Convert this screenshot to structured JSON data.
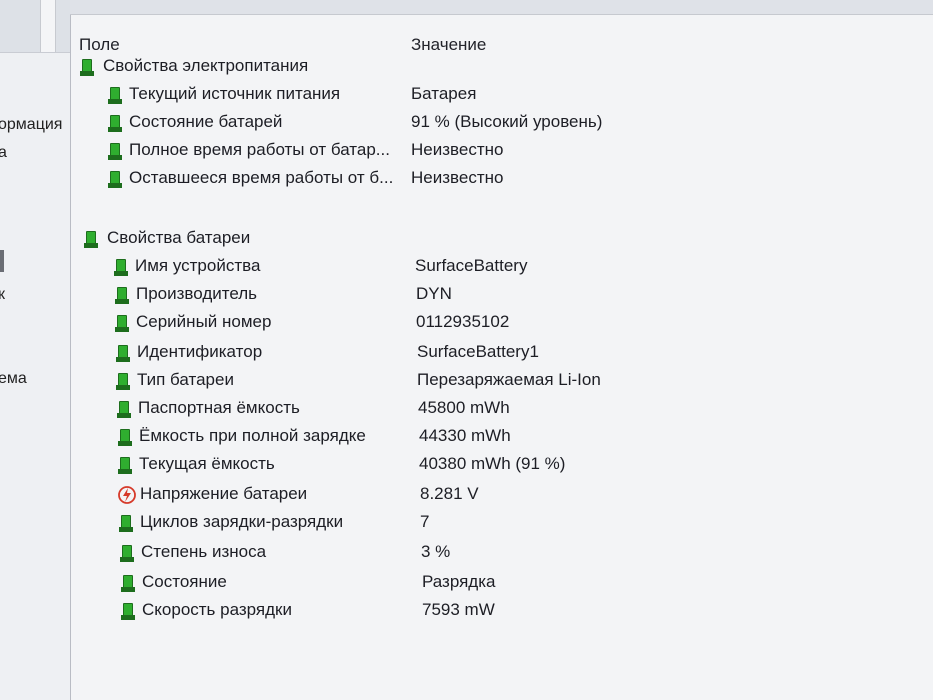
{
  "left_panel": {
    "items": [
      {
        "label": "ормация"
      },
      {
        "label": "а"
      },
      {
        "label": "к"
      },
      {
        "label": "ема"
      }
    ]
  },
  "header": {
    "field_label": "Поле",
    "value_label": "Значение"
  },
  "sections": [
    {
      "title": "Свойства электропитания",
      "rows": [
        {
          "field": "Текущий источник питания",
          "value": "Батарея",
          "icon": "battery-icon"
        },
        {
          "field": "Состояние батарей",
          "value": "91 % (Высокий уровень)",
          "icon": "battery-icon"
        },
        {
          "field": "Полное время работы от батар...",
          "value": "Неизвестно",
          "icon": "battery-icon"
        },
        {
          "field": "Оставшееся время работы от б...",
          "value": "Неизвестно",
          "icon": "battery-icon"
        }
      ]
    },
    {
      "title": "Свойства батареи",
      "rows": [
        {
          "field": "Имя устройства",
          "value": "SurfaceBattery",
          "icon": "battery-icon"
        },
        {
          "field": "Производитель",
          "value": "DYN",
          "icon": "battery-icon"
        },
        {
          "field": "Серийный номер",
          "value": "0112935102",
          "icon": "battery-icon"
        },
        {
          "field": "Идентификатор",
          "value": "SurfaceBattery1",
          "icon": "battery-icon"
        },
        {
          "field": "Тип батареи",
          "value": "Перезаряжаемая Li-Ion",
          "icon": "battery-icon"
        },
        {
          "field": "Паспортная ёмкость",
          "value": "45800 mWh",
          "icon": "battery-icon"
        },
        {
          "field": "Ёмкость при полной зарядке",
          "value": "44330 mWh",
          "icon": "battery-icon"
        },
        {
          "field": "Текущая ёмкость",
          "value": "40380 mWh  (91 %)",
          "icon": "battery-icon"
        },
        {
          "field": "Напряжение батареи",
          "value": "8.281 V",
          "icon": "bolt-icon"
        },
        {
          "field": "Циклов зарядки-разрядки",
          "value": "7",
          "icon": "battery-icon"
        },
        {
          "field": "Степень износа",
          "value": "3 %",
          "icon": "battery-icon"
        },
        {
          "field": "Состояние",
          "value": "Разрядка",
          "icon": "battery-icon"
        },
        {
          "field": "Скорость разрядки",
          "value": "7593 mW",
          "icon": "battery-icon"
        }
      ]
    }
  ],
  "colors": {
    "battery_green": "#2fae2f",
    "battery_dark": "#1d6d1d",
    "bolt_red": "#d63a2a"
  }
}
